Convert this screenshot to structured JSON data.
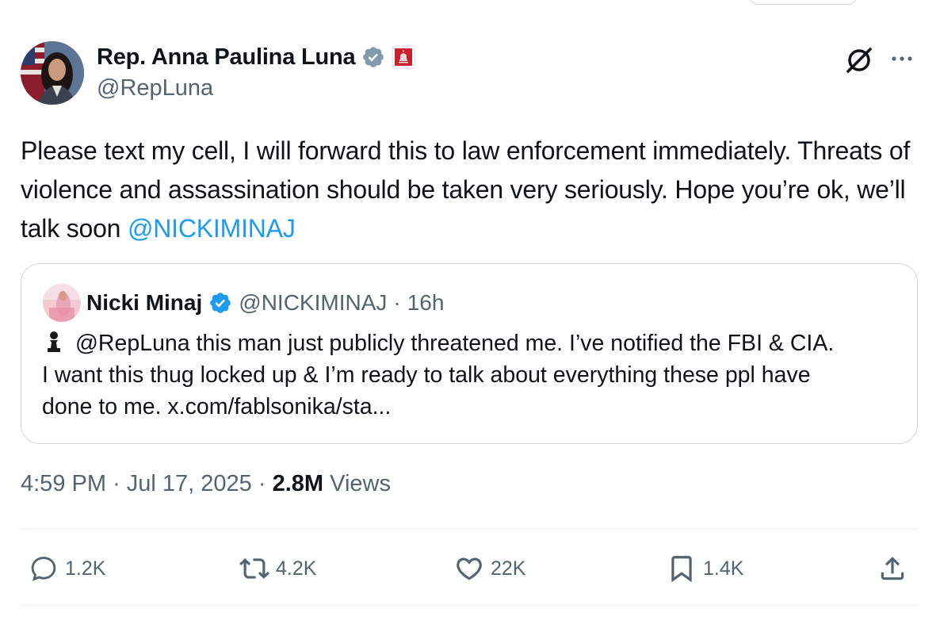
{
  "author": {
    "name": "Rep. Anna Paulina Luna",
    "handle": "@RepLuna",
    "verified_color": "#829aab",
    "badge_color": "#c8202f"
  },
  "tweet": {
    "text": "Please text my cell, I will forward this to law enforcement immediately. Threats of violence and assassination should be taken very seriously. Hope you’re ok, we’ll talk soon",
    "mention": "@NICKIMINAJ",
    "time": "4:59 PM",
    "date": "Jul 17, 2025",
    "views_count": "2.8M",
    "views_label": "Views"
  },
  "quote": {
    "name": "Nicki Minaj",
    "handle": "@NICKIMINAJ",
    "age": "16h",
    "emoji": "pawn-icon",
    "text_line1": "@RepLuna this man just publicly threatened me. I’ve notified the FBI & CIA.",
    "text_line2": "I want this thug locked up & I’m ready to talk about everything these ppl have",
    "text_line3": "done to me. x.com/fablsonika/sta..."
  },
  "actions": {
    "replies": "1.2K",
    "reposts": "4.2K",
    "likes": "22K",
    "bookmarks": "1.4K"
  },
  "colors": {
    "text": "#0f1419",
    "secondary": "#536471",
    "link": "#1d9bf0",
    "border": "#cfd9de",
    "verified_blue": "#1d9bf0"
  }
}
